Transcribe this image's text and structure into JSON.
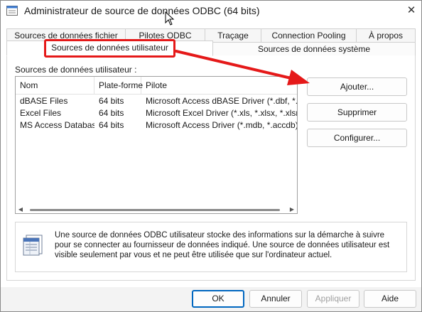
{
  "window": {
    "title": "Administrateur de source de données ODBC (64 bits)",
    "close_glyph": "✕"
  },
  "tabs": {
    "back_row": [
      "Sources de données fichier",
      "Pilotes ODBC",
      "Traçage",
      "Connection Pooling",
      "À propos"
    ],
    "front_row": [
      "Sources de données utilisateur",
      "Sources de données système"
    ],
    "active": "Sources de données utilisateur"
  },
  "annotation": {
    "highlight_color": "#e51919",
    "highlight_target": "Sources de données utilisateur",
    "arrow_target": "Ajouter..."
  },
  "list": {
    "label": "Sources de données utilisateur :",
    "columns": [
      "Nom",
      "Plate-forme",
      "Pilote"
    ],
    "rows": [
      {
        "name": "dBASE Files",
        "platform": "64 bits",
        "driver": "Microsoft Access dBASE Driver (*.dbf, *.ndx, *.mdx)"
      },
      {
        "name": "Excel Files",
        "platform": "64 bits",
        "driver": "Microsoft Excel Driver (*.xls, *.xlsx, *.xlsm, *.xlsb)"
      },
      {
        "name": "MS Access Database",
        "platform": "64 bits",
        "driver": "Microsoft Access Driver (*.mdb, *.accdb)"
      }
    ]
  },
  "side_buttons": {
    "add": "Ajouter...",
    "remove": "Supprimer",
    "configure": "Configurer..."
  },
  "info": {
    "icon": "odbc-datasource-icon",
    "text": "Une source de données ODBC utilisateur stocke des informations sur la démarche à suivre pour se connecter au fournisseur de données indiqué.  Une source de données utilisateur est visible seulement par vous et ne peut être utilisée que sur l'ordinateur actuel."
  },
  "footer_buttons": {
    "ok": "OK",
    "cancel": "Annuler",
    "apply": "Appliquer",
    "help": "Aide"
  }
}
